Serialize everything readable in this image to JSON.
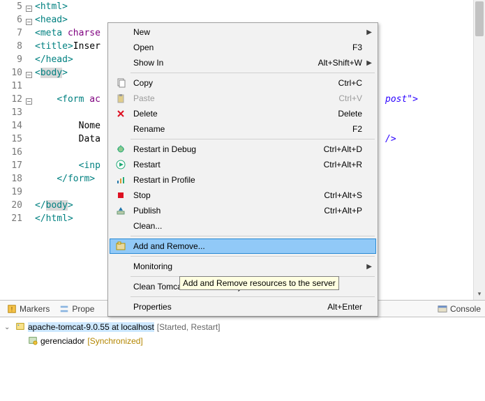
{
  "editor": {
    "lines": [
      {
        "n": "5",
        "fold": true,
        "html": "<html>"
      },
      {
        "n": "6",
        "fold": true,
        "html": "<head>"
      },
      {
        "n": "7",
        "html": "<meta charse"
      },
      {
        "n": "8",
        "html": "<title>Inser"
      },
      {
        "n": "9",
        "html": "</head>"
      },
      {
        "n": "10",
        "fold": true,
        "html": "<body>"
      },
      {
        "n": "11",
        "html": ""
      },
      {
        "n": "12",
        "fold": true,
        "html": "    <form ac",
        "trail": "post\">"
      },
      {
        "n": "13",
        "html": ""
      },
      {
        "n": "14",
        "html": "        Nome"
      },
      {
        "n": "15",
        "html": "        Data",
        "trail": "/>"
      },
      {
        "n": "16",
        "html": ""
      },
      {
        "n": "17",
        "html": "        <inp"
      },
      {
        "n": "18",
        "html": "    </form>"
      },
      {
        "n": "19",
        "html": ""
      },
      {
        "n": "20",
        "html": "</body>"
      },
      {
        "n": "21",
        "html": "</html>"
      }
    ]
  },
  "context_menu": {
    "items": [
      {
        "label": "New",
        "submenu": true
      },
      {
        "label": "Open",
        "shortcut": "F3"
      },
      {
        "label": "Show In",
        "shortcut": "Alt+Shift+W",
        "submenu": true
      },
      {
        "sep": true
      },
      {
        "label": "Copy",
        "shortcut": "Ctrl+C",
        "icon": "copy"
      },
      {
        "label": "Paste",
        "shortcut": "Ctrl+V",
        "icon": "paste",
        "disabled": true
      },
      {
        "label": "Delete",
        "shortcut": "Delete",
        "icon": "delete"
      },
      {
        "label": "Rename",
        "shortcut": "F2"
      },
      {
        "sep": true
      },
      {
        "label": "Restart in Debug",
        "shortcut": "Ctrl+Alt+D",
        "icon": "debug"
      },
      {
        "label": "Restart",
        "shortcut": "Ctrl+Alt+R",
        "icon": "run"
      },
      {
        "label": "Restart in Profile",
        "icon": "profile"
      },
      {
        "label": "Stop",
        "shortcut": "Ctrl+Alt+S",
        "icon": "stop"
      },
      {
        "label": "Publish",
        "shortcut": "Ctrl+Alt+P",
        "icon": "publish"
      },
      {
        "label": "Clean..."
      },
      {
        "sep": true
      },
      {
        "label": "Add and Remove...",
        "icon": "addremove",
        "highlighted": true
      },
      {
        "sep": true
      },
      {
        "label": "Monitoring",
        "submenu": true
      },
      {
        "sep": true
      },
      {
        "label": "Clean Tomcat Work Directory..."
      },
      {
        "sep": true
      },
      {
        "label": "Properties",
        "shortcut": "Alt+Enter"
      }
    ]
  },
  "tooltip": "Add and Remove resources to the server",
  "bottom": {
    "tabs": {
      "markers": "Markers",
      "properties": "Prope",
      "console": "Console"
    },
    "server": {
      "name": "apache-tomcat-9.0.55 at localhost",
      "status": "[Started, Restart]"
    },
    "module": {
      "name": "gerenciador",
      "status": "[Synchronized]"
    }
  }
}
